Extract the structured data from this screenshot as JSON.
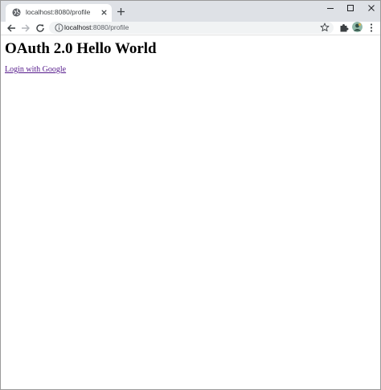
{
  "browser": {
    "tab": {
      "title": "localhost:8080/profile",
      "favicon": "globe-icon"
    },
    "toolbar": {
      "url_host": "localhost",
      "url_path": ":8080/profile"
    },
    "icons": {
      "back": "arrow-left-icon",
      "forward": "arrow-right-icon",
      "reload": "reload-icon",
      "info": "info-icon",
      "bookmark": "star-icon",
      "extensions": "puzzle-icon",
      "menu": "kebab-menu-icon"
    }
  },
  "page": {
    "heading": "OAuth 2.0 Hello World",
    "login_link": "Login with Google"
  },
  "colors": {
    "tabstrip": "#dee1e6",
    "omnibox": "#f1f3f4",
    "visited_link": "#551a8b"
  }
}
